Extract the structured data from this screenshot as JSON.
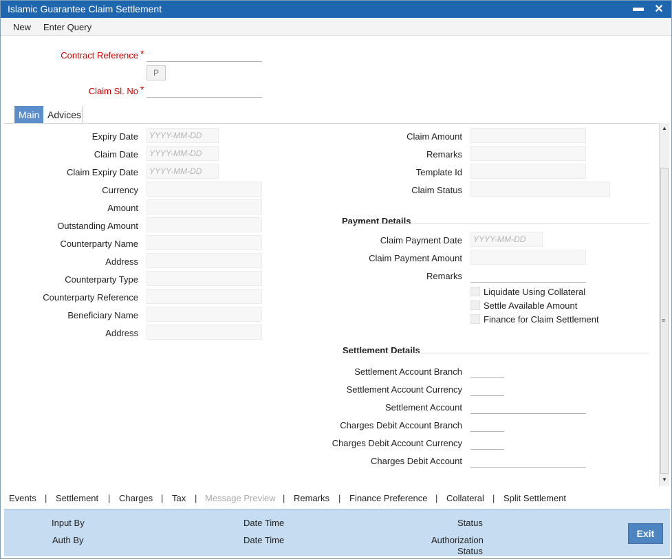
{
  "window": {
    "title": "Islamic Guarantee Claim Settlement",
    "minimize_glyph": "▬",
    "close_glyph": "✕"
  },
  "menu": {
    "new": "New",
    "enter_query": "Enter Query"
  },
  "header": {
    "contract_reference_label": "Contract Reference",
    "p_button": "P",
    "claim_sl_no_label": "Claim Sl. No",
    "required_mark": "*"
  },
  "tabs": {
    "main": "Main",
    "advices": "Advices"
  },
  "left_fields": {
    "expiry_date": "Expiry Date",
    "claim_date": "Claim Date",
    "claim_expiry_date": "Claim Expiry Date",
    "currency": "Currency",
    "amount": "Amount",
    "outstanding_amount": "Outstanding Amount",
    "counterparty_name": "Counterparty Name",
    "address": "Address",
    "counterparty_type": "Counterparty Type",
    "counterparty_reference": "Counterparty Reference",
    "beneficiary_name": "Beneficiary Name",
    "address2": "Address",
    "date_placeholder": "YYYY-MM-DD"
  },
  "right_fields": {
    "claim_amount": "Claim Amount",
    "remarks": "Remarks",
    "template_id": "Template Id",
    "claim_status": "Claim Status"
  },
  "payment_details": {
    "title": "Payment Details",
    "claim_payment_date": "Claim Payment Date",
    "date_placeholder": "YYYY-MM-DD",
    "claim_payment_amount": "Claim Payment Amount",
    "remarks": "Remarks",
    "liquidate_using_collateral": "Liquidate Using Collateral",
    "settle_available_amount": "Settle Available Amount",
    "finance_for_claim_settlement": "Finance for Claim Settlement"
  },
  "settlement_details": {
    "title": "Settlement Details",
    "settlement_account_branch": "Settlement Account Branch",
    "settlement_account_currency": "Settlement Account Currency",
    "settlement_account": "Settlement Account",
    "charges_debit_account_branch": "Charges Debit Account Branch",
    "charges_debit_account_currency": "Charges Debit Account Currency",
    "charges_debit_account": "Charges Debit Account"
  },
  "links": {
    "events": "Events",
    "settlement": "Settlement",
    "charges": "Charges",
    "tax": "Tax",
    "message_preview": "Message Preview",
    "remarks": "Remarks",
    "finance_preference": "Finance Preference",
    "collateral": "Collateral",
    "split_settlement": "Split Settlement",
    "separator": "|"
  },
  "footer": {
    "input_by": "Input By",
    "auth_by": "Auth By",
    "date_time_1": "Date Time",
    "date_time_2": "Date Time",
    "status": "Status",
    "authorization": "Authorization",
    "authorization_status": "Status",
    "exit": "Exit"
  },
  "colors": {
    "titlebar": "#1f66b0",
    "accent": "#5b8ecb",
    "footer": "#c6dcf0",
    "required": "#d40000"
  }
}
